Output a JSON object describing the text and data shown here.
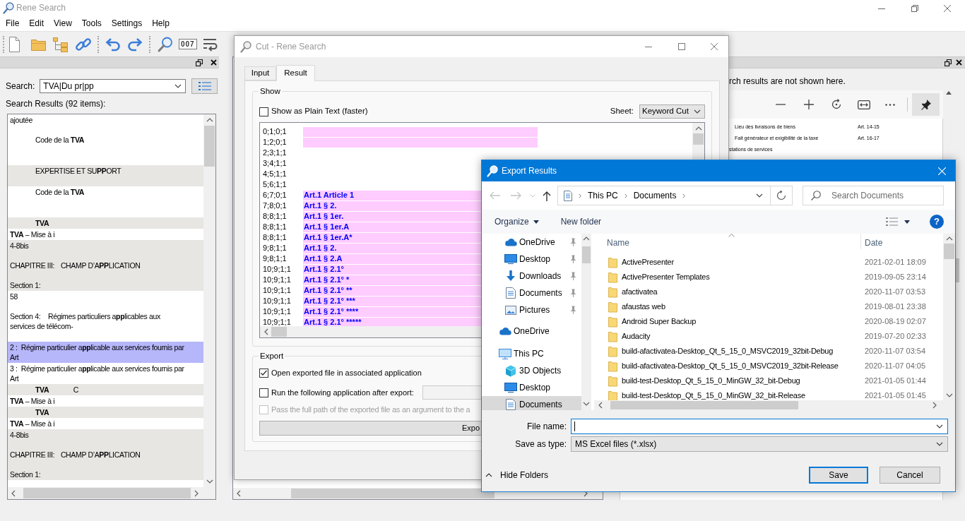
{
  "window": {
    "title": "Rene Search",
    "menu": [
      "File",
      "Edit",
      "View",
      "Tools",
      "Settings",
      "Help"
    ],
    "counter_digits": "007"
  },
  "search_panel": {
    "label": "Search:",
    "query": "TVA|Du pr|pp",
    "results_label": "Search Results (92 items):",
    "results": [
      {
        "text": "ajoutée\n\n\t\tCode de la **TVA**\n\n",
        "selected": false
      },
      {
        "text": "\t\tEXPERTISE ET SU**PP**ORT\n",
        "selected": false
      },
      {
        "text": "\t\tCode de la **TVA**\n\n",
        "selected": false
      },
      {
        "text": "\t\t**TVA**",
        "selected": false
      },
      {
        "text": "**TVA** – Mise à i",
        "selected": false
      },
      {
        "text": "4-8bis\n\nCHAPITRE III:\tCHAMP D’A**PP**LICATION\n\nSection 1:",
        "selected": false
      },
      {
        "text": "58\n\nSection 4:\tRégimes particuliers a**pp**licables aux\nservices de télécom-\n",
        "selected": false
      },
      {
        "text": "2 :  Régime particulier a**pp**licable aux services fournis par\nArt",
        "selected": true
      },
      {
        "text": "3 :  Régime particulier a**pp**licable aux services fournis par\nArt",
        "selected": false
      },
      {
        "text": "\t\t**TVA**\t\tC",
        "selected": false
      },
      {
        "text": "**TVA** – Mise à i",
        "selected": false
      },
      {
        "text": "\t\t**TVA**",
        "selected": false
      },
      {
        "text": "**TVA** – Mise à i",
        "selected": false
      },
      {
        "text": "4-8bis\n\nCHAPITRE III:\tCHAMP D’A**PP**LICATION\n\nSection 1:",
        "selected": false
      }
    ]
  },
  "preview_panel": {
    "notice": "rch results are not shown here.",
    "pin_on": true,
    "page_lines": [
      {
        "kind": "entry",
        "text": "Lieu des livraisons de biens",
        "ref": "Art. 14-15"
      },
      {
        "kind": "entry",
        "text": "Fait générateur et exigibilité de la taxe",
        "ref": "Art. 16-17"
      },
      {
        "kind": "heading",
        "text": "stations de services"
      }
    ]
  },
  "cut_dialog": {
    "title": "Cut - Rene Search",
    "tabs": [
      {
        "label": "Input",
        "selected": false
      },
      {
        "label": "Result",
        "selected": true
      }
    ],
    "show": {
      "title": "Show",
      "plain_text": {
        "label": "Show as Plain Text (faster)",
        "checked": false
      },
      "sheet_label": "Sheet:",
      "sheet": "Keyword Cut",
      "rows": [
        {
          "position": "0;1;0;1",
          "highlighted": true
        },
        {
          "position": "1;2;0;1",
          "highlighted": true
        },
        {
          "position": "2;3;1;1",
          "highlighted": false
        },
        {
          "position": "3;4;1;1",
          "highlighted": false
        },
        {
          "position": "4;5;1;1",
          "highlighted": false
        },
        {
          "position": "5;6;1;1",
          "highlighted": false
        },
        {
          "position": "6;7;0;1",
          "highlighted": true,
          "keyword": "Art.1 Article 1"
        },
        {
          "position": "7;8;0;1",
          "highlighted": true,
          "keyword": "Art.1 § 2."
        },
        {
          "position": "8;8;1;1",
          "highlighted": true,
          "keyword": "Art.1 § 1er."
        },
        {
          "position": "8;8;1;1",
          "highlighted": true,
          "keyword": "Art.1 § 1er.A"
        },
        {
          "position": "8;8;1;1",
          "highlighted": true,
          "keyword": "Art.1 § 1er.A*"
        },
        {
          "position": "9;8;1;1",
          "highlighted": true,
          "keyword": "Art.1 § 2."
        },
        {
          "position": "9;8;1;1",
          "highlighted": true,
          "keyword": "Art.1 § 2.A"
        },
        {
          "position": "10;9;1;1",
          "highlighted": true,
          "keyword": "Art.1 § 2.1°"
        },
        {
          "position": "10;9;1;1",
          "highlighted": true,
          "keyword": "Art.1 § 2.1° *"
        },
        {
          "position": "10;9;1;1",
          "highlighted": true,
          "keyword": "Art.1 § 2.1° **"
        },
        {
          "position": "10;9;1;1",
          "highlighted": true,
          "keyword": "Art.1 § 2.1° ***"
        },
        {
          "position": "10;9;1;1",
          "highlighted": true,
          "keyword": "Art.1 § 2.1° ****"
        },
        {
          "position": "10;9;1;1",
          "highlighted": true,
          "keyword": "Art.1 § 2.1° *****"
        }
      ]
    },
    "export": {
      "title": "Export",
      "open_file": {
        "label": "Open exported file in associated application",
        "checked": true
      },
      "run_app": {
        "label": "Run the following application after export:",
        "checked": false
      },
      "pass_path": {
        "label": "Pass the full path of the exported file as an argument to the a",
        "checked": false,
        "disabled": true
      },
      "button": "Expo"
    }
  },
  "export_dialog": {
    "title": "Export Results",
    "nav_buttons": [
      {
        "kind": "back",
        "disabled": true
      },
      {
        "kind": "forward",
        "disabled": true
      },
      {
        "kind": "recent",
        "disabled": true
      },
      {
        "kind": "up",
        "disabled": false
      }
    ],
    "path": [
      "This PC",
      "Documents"
    ],
    "search_placeholder": "Search Documents",
    "commands": [
      {
        "label": "Organize",
        "menu": true
      },
      {
        "label": "New folder",
        "menu": false
      }
    ],
    "help": "?",
    "quick_access": [
      {
        "label": "OneDrive",
        "kind": "onedrive",
        "pinned": true,
        "selected": false
      },
      {
        "label": "Desktop",
        "kind": "desktop",
        "pinned": true,
        "selected": false
      },
      {
        "label": "Downloads",
        "kind": "downloads",
        "pinned": true,
        "selected": false
      },
      {
        "label": "Documents",
        "kind": "documents",
        "pinned": true,
        "selected": false
      },
      {
        "label": "Pictures",
        "kind": "pictures",
        "pinned": true,
        "selected": false
      }
    ],
    "tree": [
      {
        "label": "OneDrive",
        "kind": "onedrive",
        "selected": false
      },
      {
        "label": "This PC",
        "kind": "computer",
        "selected": false,
        "children": [
          {
            "label": "3D Objects",
            "kind": "objects",
            "selected": false
          },
          {
            "label": "Desktop",
            "kind": "desktop",
            "selected": false
          },
          {
            "label": "Documents",
            "kind": "documents",
            "selected": true
          }
        ]
      }
    ],
    "columns": [
      "Name",
      "Date"
    ],
    "files": [
      {
        "name": "ActivePresenter",
        "date": "2021-02-01 18:09"
      },
      {
        "name": "ActivePresenter Templates",
        "date": "2019-09-05 23:14"
      },
      {
        "name": "afactivatea",
        "date": "2020-11-07 03:53"
      },
      {
        "name": "afaustas web",
        "date": "2019-08-01 23:38"
      },
      {
        "name": "Android Super Backup",
        "date": "2020-08-19 02:07"
      },
      {
        "name": "Audacity",
        "date": "2019-07-20 02:33"
      },
      {
        "name": "build-afactivatea-Desktop_Qt_5_15_0_MSVC2019_32bit-Debug",
        "date": "2020-11-07 03:54"
      },
      {
        "name": "build-afactivatea-Desktop_Qt_5_15_0_MSVC2019_32bit-Release",
        "date": "2020-11-07 04:05"
      },
      {
        "name": "build-test-Desktop_Qt_5_15_0_MinGW_32_bit-Debug",
        "date": "2021-01-05 01:44"
      },
      {
        "name": "build-test-Desktop_Qt_5_15_0_MinGW_32_bit-Release",
        "date": "2021-01-05 01:45"
      }
    ],
    "file_name_label": "File name:",
    "save_type_label": "Save as type:",
    "save_type": "MS Excel files (*.xlsx)",
    "hide_folders": "Hide Folders",
    "buttons": [
      {
        "label": "Save",
        "default": true
      },
      {
        "label": "Cancel",
        "default": false
      }
    ]
  }
}
